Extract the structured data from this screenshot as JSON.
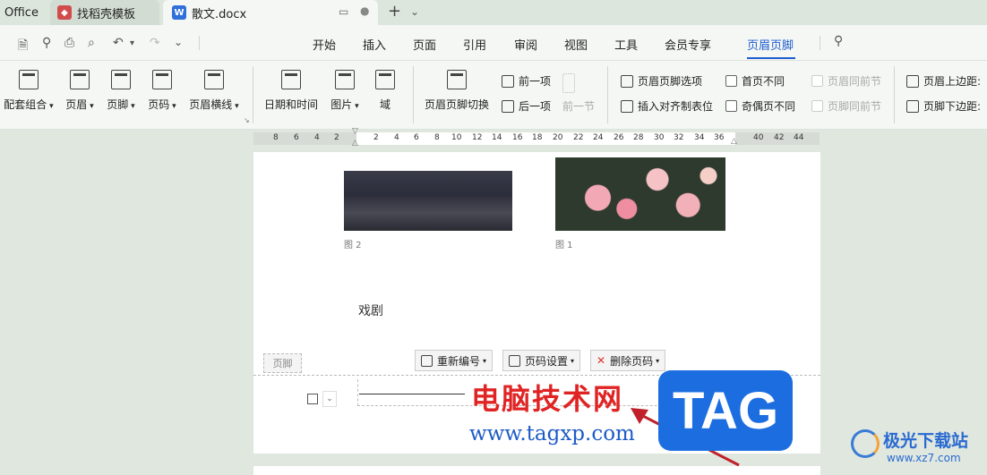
{
  "tabs": {
    "office": "Office",
    "template": "找稻壳模板",
    "doc": "散文.docx",
    "template_icon": "wps-docer-icon",
    "doc_icon": "word-doc-icon",
    "doc_icon_letter": "W"
  },
  "menu": {
    "items": [
      "开始",
      "插入",
      "页面",
      "引用",
      "审阅",
      "视图",
      "工具",
      "会员专享",
      "页眉页脚"
    ],
    "active": "页眉页脚",
    "active_color": "#1f5ecf"
  },
  "ribbon": {
    "group1": [
      "配套组合",
      "页眉",
      "页脚",
      "页码",
      "页眉横线"
    ],
    "group2": [
      "日期和时间",
      "图片",
      "域"
    ],
    "switch": "页眉页脚切换",
    "prev": "前一项",
    "next": "后一项",
    "prev_section": "前一节",
    "options": "页眉页脚选项",
    "insert_tab": "插入对齐制表位",
    "first_page": "首页不同",
    "odd_even": "奇偶页不同",
    "header_same": "页眉同前节",
    "footer_same": "页脚同前节",
    "header_top": "页眉上边距:",
    "footer_bottom": "页脚下边距:"
  },
  "ruler": {
    "left_numbers": [
      "8",
      "6",
      "4",
      "2"
    ],
    "right_numbers": [
      "2",
      "4",
      "6",
      "8",
      "10",
      "12",
      "14",
      "16",
      "18",
      "20",
      "22",
      "24",
      "26",
      "28",
      "30",
      "32",
      "34",
      "36",
      "40",
      "42",
      "44"
    ]
  },
  "document": {
    "caption2": "图 2",
    "caption1": "图 1",
    "body_text": "戏剧",
    "footer_label": "页脚",
    "renumber": "重新编号",
    "page_settings": "页码设置",
    "delete_page_num": "删除页码"
  },
  "watermark": {
    "title": "电脑技术网",
    "url": "www.tagxp.com",
    "tag": "TAG",
    "site_name": "极光下载站",
    "site_url": "www.xz7.com"
  },
  "colors": {
    "accent": "#1f5ecf",
    "watermark_red": "#e02424",
    "watermark_blue": "#1c6ee0"
  }
}
